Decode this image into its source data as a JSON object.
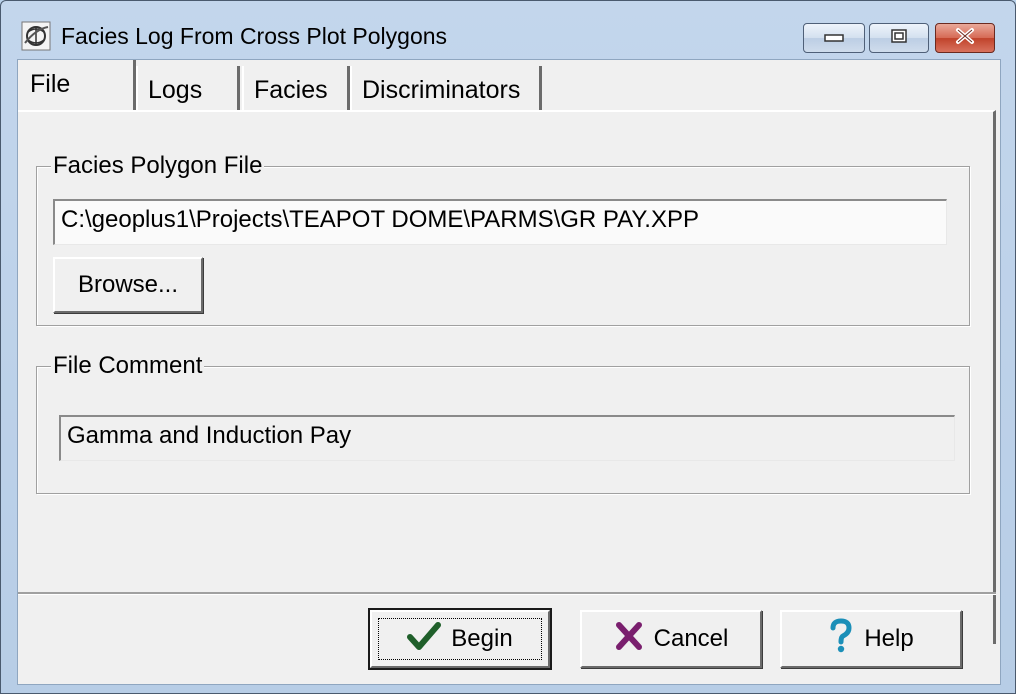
{
  "window": {
    "title": "Facies Log From Cross Plot Polygons",
    "app_icon": "geoplus-globe-icon",
    "controls": [
      "minimize-icon",
      "maximize-icon",
      "close-icon"
    ]
  },
  "tabs": [
    {
      "label": "File",
      "active": true
    },
    {
      "label": "Logs",
      "active": false
    },
    {
      "label": "Facies",
      "active": false
    },
    {
      "label": "Discriminators",
      "active": false
    }
  ],
  "facies_polygon_file": {
    "group_label": "Facies Polygon File",
    "path_value": "C:\\geoplus1\\Projects\\TEAPOT DOME\\PARMS\\GR PAY.XPP",
    "browse_label": "Browse..."
  },
  "file_comment": {
    "group_label": "File Comment",
    "value": "Gamma and Induction Pay"
  },
  "footer": {
    "begin_label": "Begin",
    "begin_icon": "checkmark-icon",
    "cancel_label": "Cancel",
    "cancel_icon": "x-icon",
    "help_label": "Help",
    "help_icon": "question-mark-icon"
  },
  "colors": {
    "check": "#1f5f2a",
    "cancel_x": "#7a1f6e",
    "help_q": "#1b8fb8"
  }
}
